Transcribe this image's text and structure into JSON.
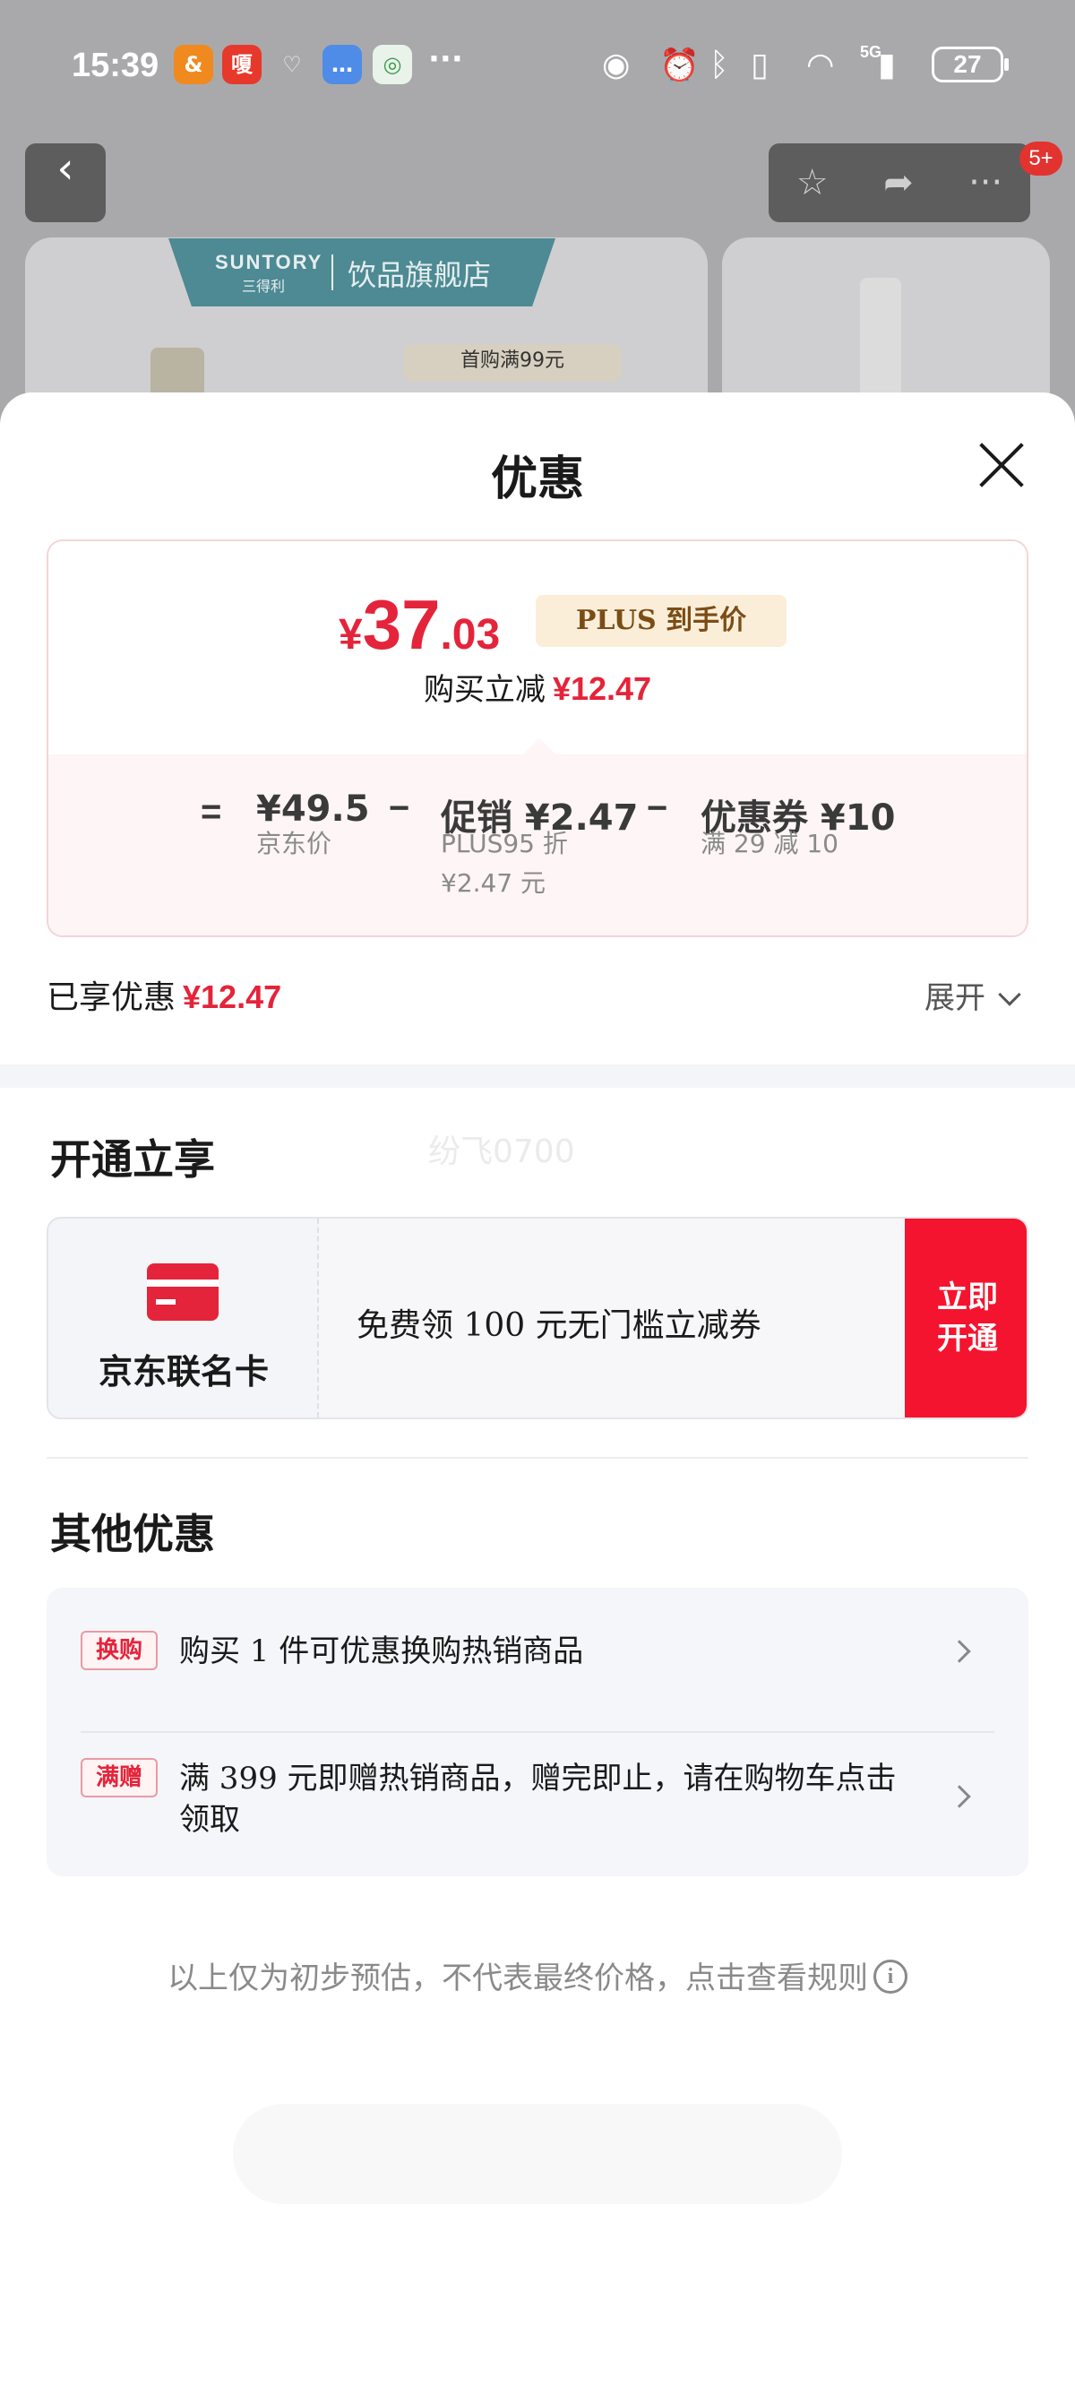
{
  "status_bar": {
    "time": "15:39",
    "app_badges": [
      {
        "label": "&",
        "color": "#f08a1e"
      },
      {
        "label": "嗄",
        "color": "#e6392c"
      },
      {
        "label": "♡",
        "color": "#bcbcbc"
      },
      {
        "label": "…",
        "color": "#4e8ce8"
      },
      {
        "label": "◎",
        "color": "#e9f3ea"
      }
    ],
    "more": "···",
    "network": "5G",
    "battery": "27"
  },
  "background_page": {
    "brand_name": "SUNTORY",
    "brand_sub": "三得利",
    "store_name": "饮品旗舰店",
    "promo_tag": "首购满99元",
    "cart_badge": "5+"
  },
  "sheet": {
    "title": "优惠",
    "price": {
      "currency": "¥",
      "integer": "37",
      "decimal": ".03",
      "plus_badge": "PLUS 到手价",
      "save_label": "购买立减",
      "save_value": "¥12.47"
    },
    "breakdown": [
      {
        "operator": "=",
        "main": "¥49.5",
        "sub": [
          "京东价"
        ]
      },
      {
        "operator": "−",
        "main": "促销 ¥2.47",
        "sub": [
          "PLUS95 折",
          "¥2.47 元"
        ]
      },
      {
        "operator": "−",
        "main": "优惠券 ¥10",
        "sub": [
          "满 29 减 10"
        ]
      }
    ],
    "enjoyed_label": "已享优惠",
    "enjoyed_value": "¥12.47",
    "expand_label": "展开",
    "open_section": {
      "title": "开通立享",
      "watermark": "纷飞0700",
      "card_name": "京东联名卡",
      "card_desc": "免费领 100 元无门槛立减券",
      "open_button": "立即开通"
    },
    "other_section": {
      "title": "其他优惠",
      "items": [
        {
          "tag": "换购",
          "text": "购买 1 件可优惠换购热销商品"
        },
        {
          "tag": "满赠",
          "text": "满 399 元即赠热销商品，赠完即止，请在购物车点击领取"
        }
      ]
    },
    "disclaimer": "以上仅为初步预估，不代表最终价格，点击查看规则",
    "info_icon": "i"
  }
}
